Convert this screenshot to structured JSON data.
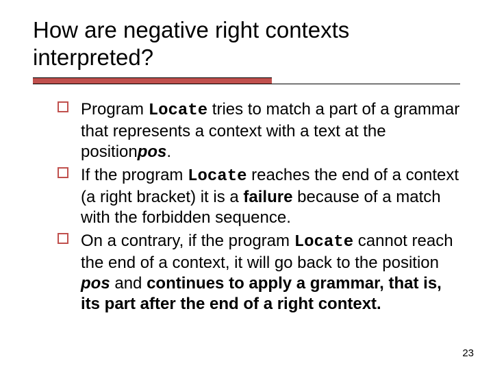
{
  "title": "How are negative right contexts interpreted?",
  "bullets": [
    {
      "p1": "Program ",
      "code1": "Locate",
      "p2": " tries to match a part of a grammar that represents a context with a text at the position",
      "pos": "pos",
      "p3": "."
    },
    {
      "p1": "If the program ",
      "code1": "Locate",
      "p2": " reaches the end of a context (a right bracket) it is a ",
      "fail": "failure",
      "p3": " because of a match with the forbidden sequence."
    },
    {
      "p1": "On a contrary, if the program ",
      "code1": "Locate",
      "p2": " cannot reach the end of a context, it will go back to the position ",
      "pos": "pos",
      "p3": " and ",
      "tail": "continues to apply a grammar, that is, its part after the end of a right context."
    }
  ],
  "page_number": "23"
}
